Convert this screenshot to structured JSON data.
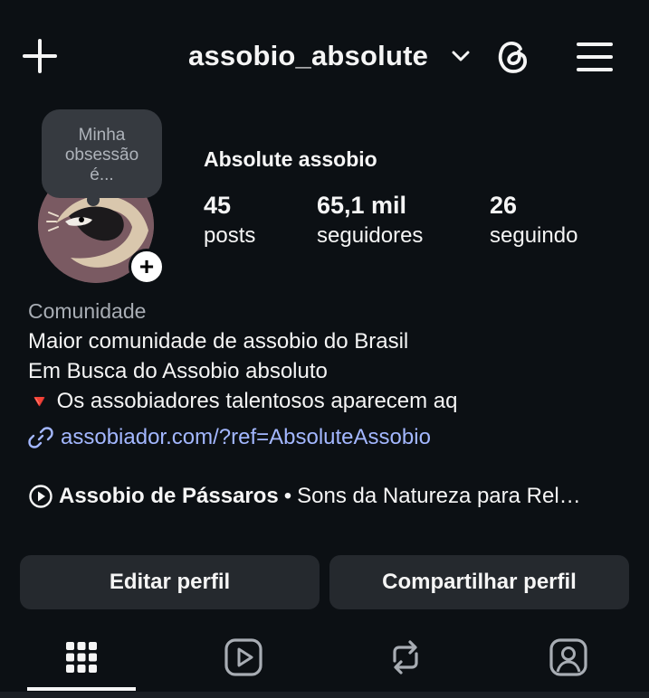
{
  "header": {
    "create_icon": "plus-icon",
    "username": "assobio_absolute",
    "switch_account_icon": "chevron-down-icon",
    "threads_icon": "threads-icon",
    "menu_icon": "hamburger-menu-icon"
  },
  "profile": {
    "note_text_1": "Minha",
    "note_text_2": "obsessão",
    "note_text_3": "é...",
    "full_name": "Absolute assobio",
    "add_story_icon": "plus-icon",
    "stats": [
      {
        "value": "45",
        "label": "posts"
      },
      {
        "value": "65,1 mil",
        "label": "seguidores"
      },
      {
        "value": "26",
        "label": "seguindo"
      }
    ]
  },
  "bio": {
    "category": "Comunidade",
    "line1": "Maior comunidade de assobio do Brasil",
    "line2": "Em Busca do Assobio absoluto",
    "line3_icon": "🔻",
    "line3": "Os assobiadores talentosos aparecem aq",
    "link": "assobiador.com/?ref=AbsoluteAssobio",
    "link_icon": "link-icon"
  },
  "music": {
    "icon": "play-circle-icon",
    "track": "Assobio de Pássaros",
    "separator": "•",
    "artist": "Sons da Natureza para Rel…"
  },
  "actions": {
    "edit_label": "Editar perfil",
    "share_label": "Compartilhar perfil"
  },
  "tabs": [
    {
      "icon": "grid-icon",
      "active": true
    },
    {
      "icon": "reels-icon",
      "active": false
    },
    {
      "icon": "reposts-icon",
      "active": false
    },
    {
      "icon": "tagged-icon",
      "active": false
    }
  ],
  "colors": {
    "background": "#0c1014",
    "button": "#25292e",
    "link": "#a3b7ff",
    "muted_text": "#a8adb4",
    "avatar_bg": "#7a5a62"
  }
}
